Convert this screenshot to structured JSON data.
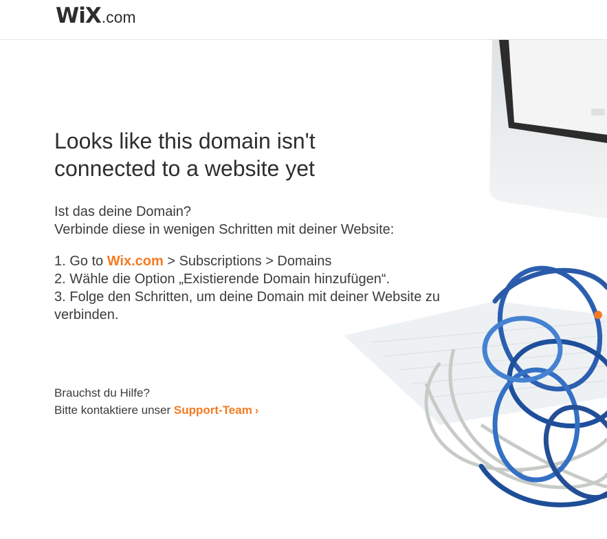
{
  "header": {
    "logo_brand": "WiX",
    "logo_tld": ".com"
  },
  "main": {
    "headline_line1": "Looks like this domain isn't",
    "headline_line2": "connected to a website yet",
    "intro_line1": "Ist das deine Domain?",
    "intro_line2": "Verbinde diese in wenigen Schritten mit deiner Website:",
    "step1_prefix": "1. Go to ",
    "step1_link": "Wix.com",
    "step1_suffix": " > Subscriptions > Domains",
    "step2": "2. Wähle die Option „Existierende Domain hinzufügen“.",
    "step3": "3. Folge den Schritten, um deine Domain mit deiner Website zu verbinden."
  },
  "help": {
    "question": "Brauchst du Hilfe?",
    "contact_prefix": "Bitte kontaktiere unser ",
    "support_link": "Support-Team",
    "chevron": "›"
  },
  "colors": {
    "accent": "#f47a22",
    "logo_dot": "#f9c00b",
    "text": "#3b3b3b"
  },
  "icons": [
    "chevron-right-icon"
  ]
}
